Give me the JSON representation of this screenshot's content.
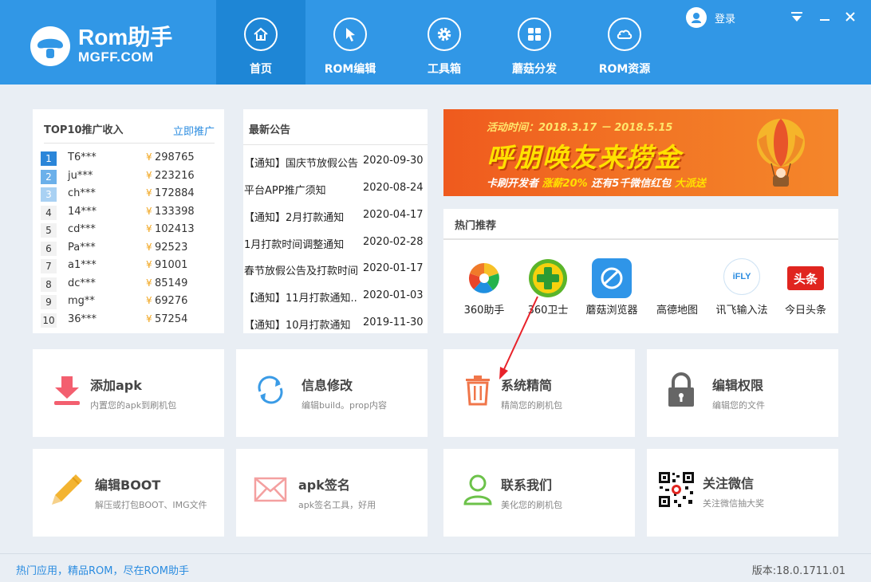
{
  "brand": {
    "title": "Rom助手",
    "subtitle": "MGFF.COM"
  },
  "nav": [
    {
      "label": "首页",
      "icon": "home-icon",
      "active": true
    },
    {
      "label": "ROM编辑",
      "icon": "cursor-icon",
      "active": false
    },
    {
      "label": "工具箱",
      "icon": "gear-icon",
      "active": false
    },
    {
      "label": "蘑菇分发",
      "icon": "grid-icon",
      "active": false
    },
    {
      "label": "ROM资源",
      "icon": "cloud-icon",
      "active": false
    }
  ],
  "login": {
    "label": "登录"
  },
  "top10": {
    "title": "TOP10推广收入",
    "link": "立即推广",
    "currency": "¥",
    "rows": [
      {
        "rank": "1",
        "name": "T6***",
        "amount": "298765"
      },
      {
        "rank": "2",
        "name": "ju***",
        "amount": "223216"
      },
      {
        "rank": "3",
        "name": "ch***",
        "amount": "172884"
      },
      {
        "rank": "4",
        "name": "14***",
        "amount": "133398"
      },
      {
        "rank": "5",
        "name": "cd***",
        "amount": "102413"
      },
      {
        "rank": "6",
        "name": "Pa***",
        "amount": "92523"
      },
      {
        "rank": "7",
        "name": "a1***",
        "amount": "91001"
      },
      {
        "rank": "8",
        "name": "dc***",
        "amount": "85149"
      },
      {
        "rank": "9",
        "name": "mg**",
        "amount": "69276"
      },
      {
        "rank": "10",
        "name": "36***",
        "amount": "57254"
      }
    ]
  },
  "notices": {
    "title": "最新公告",
    "rows": [
      {
        "text": "【通知】国庆节放假公告",
        "date": "2020-09-30"
      },
      {
        "text": "平台APP推广须知",
        "date": "2020-08-24"
      },
      {
        "text": "【通知】2月打款通知",
        "date": "2020-04-17"
      },
      {
        "text": "1月打款时间调整通知",
        "date": "2020-02-28"
      },
      {
        "text": "春节放假公告及打款时间",
        "date": "2020-01-17"
      },
      {
        "text": "【通知】11月打款通知..",
        "date": "2020-01-03"
      },
      {
        "text": "【通知】10月打款通知",
        "date": "2019-11-30"
      }
    ]
  },
  "banner": {
    "time": "活动时间：2018.3.17 － 2018.5.15",
    "headline": "呼朋唤友来捞金",
    "sub_prefix": "卡刷开发者",
    "sub_highlight1": "涨薪20%",
    "sub_mid": "还有5千微信红包",
    "sub_highlight2": "大派送"
  },
  "hot": {
    "title": "热门推荐",
    "apps": [
      {
        "label": "360助手",
        "icon": "360-assistant-icon"
      },
      {
        "label": "360卫士",
        "icon": "360-guard-icon"
      },
      {
        "label": "蘑菇浏览器",
        "icon": "mogu-browser-icon"
      },
      {
        "label": "高德地图",
        "icon": "amap-icon"
      },
      {
        "label": "讯飞输入法",
        "icon": "ifly-input-icon",
        "icon_text": "iFLY"
      },
      {
        "label": "今日头条",
        "icon": "toutiao-icon",
        "icon_text": "头条"
      }
    ]
  },
  "tiles": [
    {
      "title": "添加apk",
      "desc": "内置您的apk到刷机包",
      "icon": "download-arrow-icon"
    },
    {
      "title": "信息修改",
      "desc": "编辑build。prop内容",
      "icon": "refresh-icon"
    },
    {
      "title": "系统精简",
      "desc": "精简您的刷机包",
      "icon": "trash-icon"
    },
    {
      "title": "编辑权限",
      "desc": "编辑您的文件",
      "icon": "lock-icon"
    },
    {
      "title": "编辑BOOT",
      "desc": "解压或打包BOOT、IMG文件",
      "icon": "pencil-icon"
    },
    {
      "title": "apk签名",
      "desc": "apk签名工具，好用",
      "icon": "envelope-icon"
    },
    {
      "title": "联系我们",
      "desc": "美化您的刷机包",
      "icon": "user-icon"
    },
    {
      "title": "关注微信",
      "desc": "关注微信抽大奖",
      "icon": "qr-code-icon"
    }
  ],
  "footer": {
    "left": "热门应用，精品ROM，尽在ROM助手",
    "right": "版本:18.0.1711.01"
  },
  "colors": {
    "header": "#3197e6",
    "active_tab": "#1e86d6",
    "accent": "#2b8ce0",
    "background": "#e9eef4"
  }
}
